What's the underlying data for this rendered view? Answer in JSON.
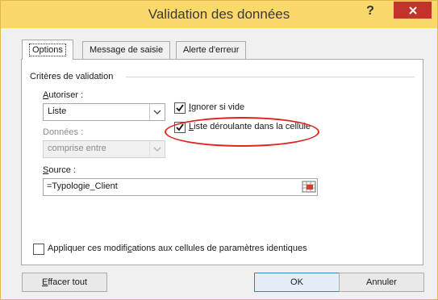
{
  "window": {
    "title": "Validation des données",
    "help_label": "?"
  },
  "tabs": [
    {
      "label": "Options",
      "active": true
    },
    {
      "label": "Message de saisie",
      "active": false
    },
    {
      "label": "Alerte d'erreur",
      "active": false
    }
  ],
  "criteria": {
    "group_label": "Critères de validation",
    "allow": {
      "label_u": "A",
      "label_rest": "utoriser :",
      "value": "Liste"
    },
    "ignore_blank": {
      "label_u": "I",
      "label_rest": "gnorer si vide",
      "checked": true
    },
    "in_cell_dropdown": {
      "label_u": "L",
      "label_rest": "iste déroulante dans la cellule",
      "checked": true
    },
    "data": {
      "label": "Données :",
      "value": "comprise entre"
    },
    "source": {
      "label_u": "S",
      "label_rest": "ource :",
      "value": "=Typologie_Client"
    }
  },
  "apply_all": {
    "label_before": "Appliquer ces modifi",
    "label_u": "c",
    "label_after": "ations aux cellules de paramètres identiques",
    "checked": false
  },
  "buttons": {
    "clear_u": "E",
    "clear_rest": "ffacer tout",
    "ok": "OK",
    "cancel": "Annuler"
  },
  "colors": {
    "titlebar": "#fbd86a",
    "close": "#c4332b",
    "annotation": "#e0241b"
  }
}
